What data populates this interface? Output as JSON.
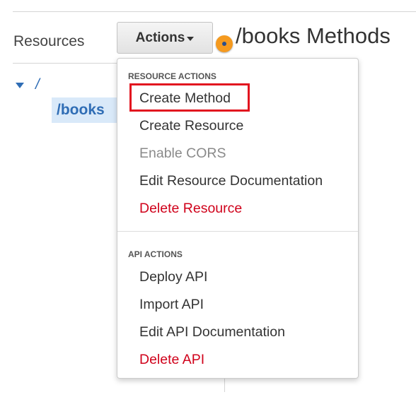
{
  "sidebar": {
    "title": "Resources",
    "tree": {
      "root": "/",
      "child": "/books"
    }
  },
  "toolbar": {
    "actions_label": "Actions"
  },
  "main": {
    "title": "/books Methods"
  },
  "menu": {
    "resource_section": "RESOURCE ACTIONS",
    "resource_items": [
      "Create Method",
      "Create Resource",
      "Enable CORS",
      "Edit Resource Documentation",
      "Delete Resource"
    ],
    "api_section": "API ACTIONS",
    "api_items": [
      "Deploy API",
      "Import API",
      "Edit API Documentation",
      "Delete API"
    ]
  },
  "colors": {
    "link_blue": "#2f6db5",
    "danger_red": "#d0021b",
    "highlight_red": "#e2141f",
    "selection_bg": "#d9e9f9",
    "dot_orange": "#f59a1f"
  }
}
